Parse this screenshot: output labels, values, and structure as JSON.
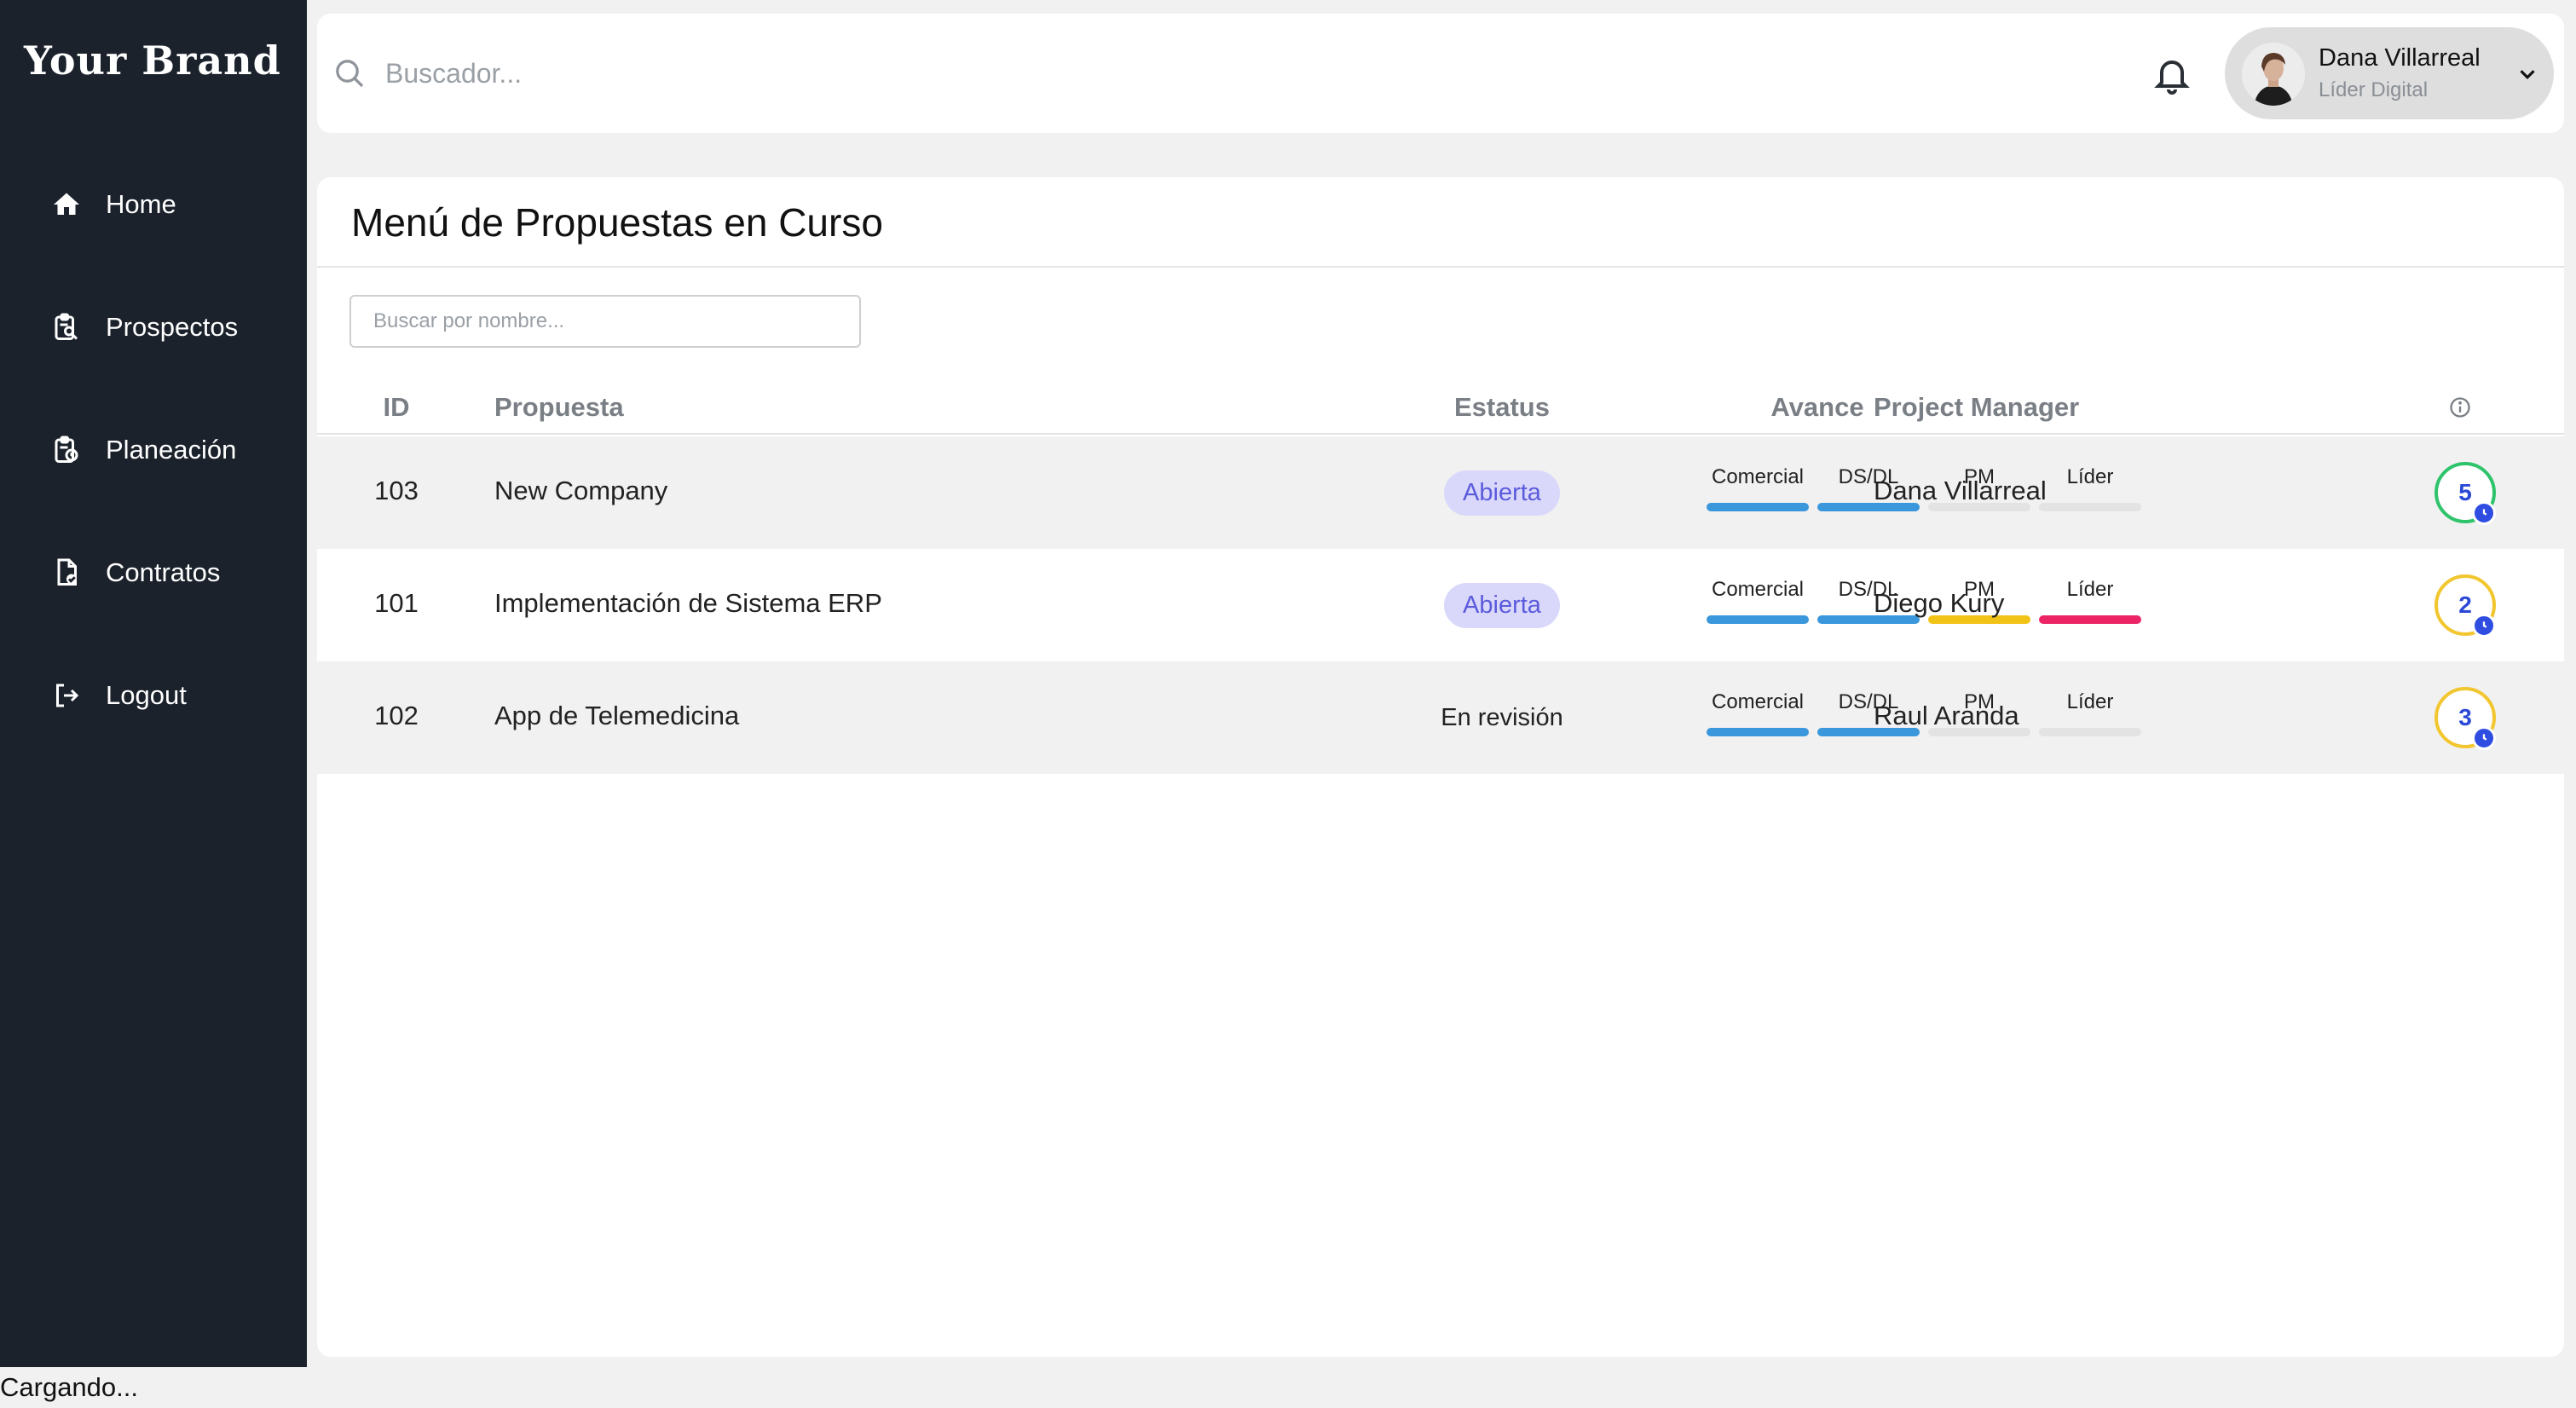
{
  "brand": "Your Brand",
  "nav": [
    {
      "label": "Home",
      "icon": "home-icon"
    },
    {
      "label": "Prospectos",
      "icon": "clipboard-search-icon"
    },
    {
      "label": "Planeación",
      "icon": "clipboard-clock-icon"
    },
    {
      "label": "Contratos",
      "icon": "document-check-icon"
    },
    {
      "label": "Logout",
      "icon": "logout-icon"
    }
  ],
  "footer_status": "Cargando...",
  "search": {
    "placeholder": "Buscador..."
  },
  "user": {
    "name": "Dana Villarreal",
    "role": "Líder Digital"
  },
  "page": {
    "title": "Menú de Propuestas en Curso",
    "filter_placeholder": "Buscar por nombre...",
    "columns": {
      "id": "ID",
      "name": "Propuesta",
      "status": "Estatus",
      "progress": "Avance",
      "pm": "Project Manager"
    },
    "stage_labels": [
      "Comercial",
      "DS/DL",
      "PM",
      "Líder"
    ]
  },
  "colors": {
    "complete": "#3a97dc",
    "pending": "#e3e3e3",
    "warning": "#f2c317",
    "alert": "#ec2466",
    "badge_bg": "#d9d8fb",
    "badge_text": "#5b5bdc",
    "ring_green": "#2fc46c",
    "ring_yellow": "#f2c62f"
  },
  "rows": [
    {
      "id": "103",
      "name": "New Company",
      "status": "Abierta",
      "status_badge": true,
      "stages": [
        "complete",
        "complete",
        "pending",
        "pending"
      ],
      "pm": "Dana Villarreal",
      "count": "5",
      "ring": "green"
    },
    {
      "id": "101",
      "name": "Implementación de Sistema ERP",
      "status": "Abierta",
      "status_badge": true,
      "stages": [
        "complete",
        "complete",
        "warning",
        "alert"
      ],
      "pm": "Diego Kury",
      "count": "2",
      "ring": "yellow"
    },
    {
      "id": "102",
      "name": "App de Telemedicina",
      "status": "En revisión",
      "status_badge": false,
      "stages": [
        "complete",
        "complete",
        "pending",
        "pending"
      ],
      "pm": "Raul Aranda",
      "count": "3",
      "ring": "yellow"
    }
  ]
}
